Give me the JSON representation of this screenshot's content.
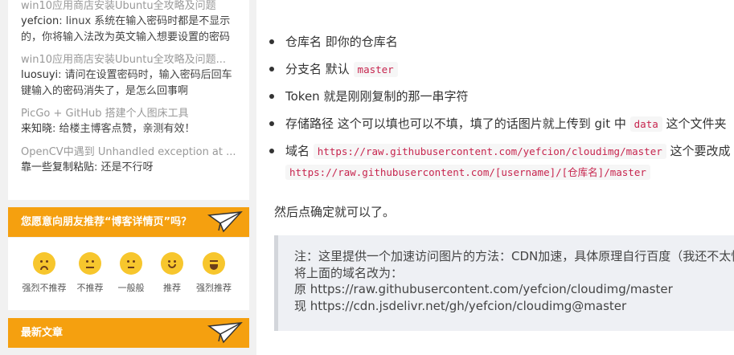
{
  "sidebar": {
    "comments": [
      {
        "title": "win10应用商店安装Ubuntu全攻略及问题",
        "author": "yefcion",
        "text": "linux 系统在输入密码时都是不显示的，你将输入法改为英文输入想要设置的密码"
      },
      {
        "title": "win10应用商店安装Ubuntu全攻略及问题...",
        "author": "luosuyi",
        "text": "请问在设置密码时，输入密码后回车键输入的密码消失了，是怎么回事啊"
      },
      {
        "title": "PicGo + GitHub 搭建个人图床工具",
        "author": "来知晓",
        "text": "给楼主博客点赞，亲测有效！"
      },
      {
        "title": "OpenCV中遇到 Unhandled exception at ...",
        "author": "靠一些复制粘贴",
        "text": "还是不行呀"
      }
    ],
    "recommend_title": "您愿意向朋友推荐“博客详情页”吗？",
    "ratings": [
      {
        "label": "强烈不推荐",
        "icon": "angry-face-icon"
      },
      {
        "label": "不推荐",
        "icon": "unhappy-face-icon"
      },
      {
        "label": "一般般",
        "icon": "neutral-face-icon"
      },
      {
        "label": "推荐",
        "icon": "smile-face-icon"
      },
      {
        "label": "强烈推荐",
        "icon": "laugh-face-icon"
      }
    ],
    "latest_title": "最新文章",
    "colors": {
      "accent": "#f5a00f",
      "face": "#f7c62d"
    }
  },
  "main": {
    "items": [
      {
        "text": "仓库名 即你的仓库名"
      },
      {
        "text": "分支名 默认 ",
        "code": "master"
      },
      {
        "text": "Token 就是刚刚复制的那一串字符"
      },
      {
        "text": "存储路径 这个可以填也可以不填，填了的话图片就上传到 git 中 ",
        "code": "data",
        "after": " 这个文件夹"
      },
      {
        "text": "域名 ",
        "code": "https://raw.githubusercontent.com/yefcion/cloudimg/master",
        "after": " 这个要改成",
        "code2": "https://raw.githubusercontent.com/[username]/[仓库名]/master"
      }
    ],
    "paragraph": "然后点确定就可以了。",
    "quote": [
      "注：这里提供一个加速访问图片的方法：CDN加速，具体原理自行百度（我还不太懂），就是",
      "将上面的域名改为：",
      "原 https://raw.githubusercontent.com/yefcion/cloudimg/master",
      "现 https://cdn.jsdelivr.net/gh/yefcion/cloudimg@master"
    ]
  }
}
